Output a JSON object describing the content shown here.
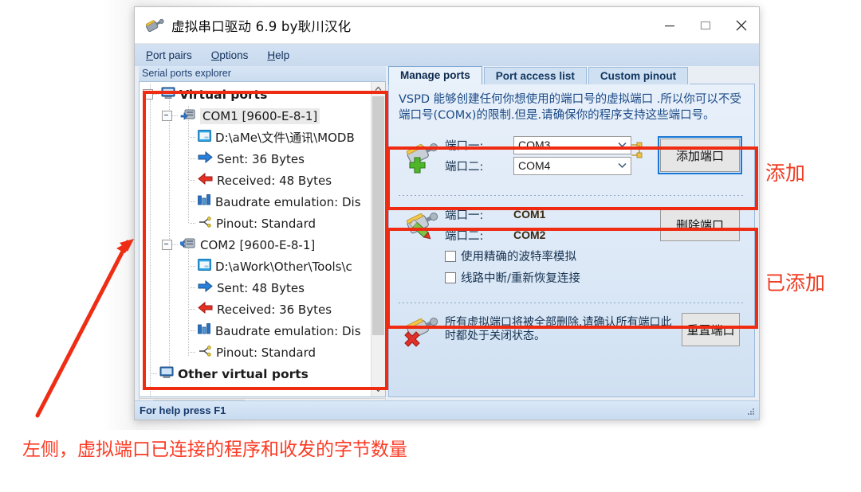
{
  "window": {
    "title": "虚拟串口驱动 6.9 by耿川汉化",
    "icon": "plug-wrench-icon",
    "controls": {
      "minimize": "minimize-icon",
      "maximize": "maximize-icon",
      "close": "close-icon"
    }
  },
  "menubar": {
    "items": [
      {
        "pre": "P",
        "post": "ort pairs"
      },
      {
        "pre": "O",
        "post": "ptions"
      },
      {
        "pre": "H",
        "post": "elp"
      }
    ]
  },
  "explorer": {
    "header": "Serial ports explorer",
    "tree": [
      {
        "level": 0,
        "label": "Virtual ports",
        "icon": "monitor-icon",
        "bold": true,
        "expander": true
      },
      {
        "level": 1,
        "label": "COM1 [9600-E-8-1]",
        "icon": "port-in-icon",
        "bold": false,
        "expander": true,
        "selected": true
      },
      {
        "level": 2,
        "label": "D:\\aMe\\文件\\通讯\\MODB",
        "icon": "application-window-icon",
        "bold": false,
        "expander": false
      },
      {
        "level": 2,
        "label": "Sent: 36 Bytes",
        "icon": "blue-arrow-right-icon",
        "bold": false,
        "expander": false
      },
      {
        "level": 2,
        "label": "Received: 48 Bytes",
        "icon": "red-arrow-left-icon",
        "bold": false,
        "expander": false
      },
      {
        "level": 2,
        "label": "Baudrate emulation: Dis",
        "icon": "bars-icon",
        "bold": false,
        "expander": false
      },
      {
        "level": 2,
        "label": "Pinout: Standard",
        "icon": "pinout-icon",
        "bold": false,
        "expander": false
      },
      {
        "level": 1,
        "label": "COM2 [9600-E-8-1]",
        "icon": "port-out-icon",
        "bold": false,
        "expander": true
      },
      {
        "level": 2,
        "label": "D:\\aWork\\Other\\Tools\\c",
        "icon": "application-window-icon",
        "bold": false,
        "expander": false
      },
      {
        "level": 2,
        "label": "Sent: 48 Bytes",
        "icon": "blue-arrow-right-icon",
        "bold": false,
        "expander": false
      },
      {
        "level": 2,
        "label": "Received: 36 Bytes",
        "icon": "red-arrow-left-icon",
        "bold": false,
        "expander": false
      },
      {
        "level": 2,
        "label": "Baudrate emulation: Dis",
        "icon": "bars-icon",
        "bold": false,
        "expander": false
      },
      {
        "level": 2,
        "label": "Pinout: Standard",
        "icon": "pinout-icon",
        "bold": false,
        "expander": false
      },
      {
        "level": 0,
        "label": "Other virtual ports",
        "icon": "monitor-icon",
        "bold": true,
        "expander": false
      }
    ]
  },
  "tabs": [
    {
      "label": "Manage ports",
      "active": true
    },
    {
      "label": "Port access list",
      "active": false
    },
    {
      "label": "Custom pinout",
      "active": false
    }
  ],
  "manage": {
    "intro": "VSPD 能够创建任何你想使用的端口号的虚拟端口 .所以你可以不受端口号(COMx)的限制.但是.请确保你的程序支持这些端口号。",
    "add": {
      "icon": "add-port-icon",
      "label_port1": "端口一:",
      "label_port2": "端口二:",
      "value_port1": "COM3",
      "value_port2": "COM4",
      "button": "添加端口"
    },
    "existing": {
      "icon": "edit-port-icon",
      "label_port1": "端口一:",
      "label_port2": "端口二:",
      "value_port1": "COM1",
      "value_port2": "COM2",
      "button": "删除端口",
      "checkbox1": "使用精确的波特率模拟",
      "checkbox2": "线路中断/重新恢复连接",
      "checkbox1_checked": false,
      "checkbox2_checked": false
    },
    "reset": {
      "icon": "reset-port-icon",
      "text": "所有虚拟端口将被全部删除.请确认所有端口此时都处于关闭状态。",
      "button": "重置端口"
    }
  },
  "statusbar": {
    "text": "For help press F1",
    "grip": "resize-grip-icon"
  },
  "annotations": {
    "accent": "#ef3b21",
    "add": "添加",
    "added": "已添加",
    "bottom": "左侧，虚拟端口已连接的程序和收发的字节数量",
    "arrow": "red-arrow-annotation"
  }
}
